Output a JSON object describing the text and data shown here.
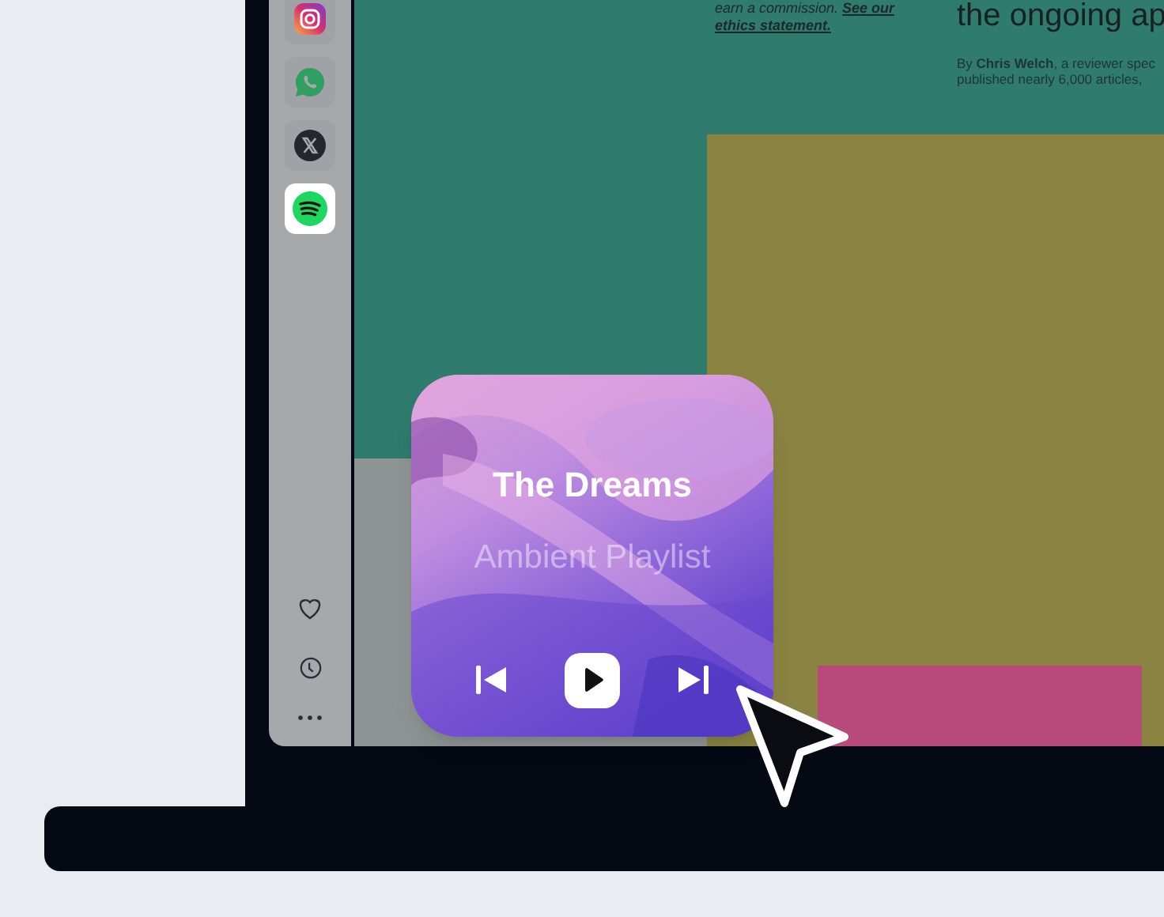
{
  "sidebar": {
    "apps": [
      {
        "kind": "instagram",
        "selected": false
      },
      {
        "kind": "whatsapp",
        "selected": false
      },
      {
        "kind": "x",
        "selected": false
      },
      {
        "kind": "spotify",
        "selected": true
      }
    ]
  },
  "article": {
    "note": "earn a commission.",
    "note_link": [
      "See our",
      "ethics statement."
    ],
    "headline": "the ongoing ap",
    "byline": [
      "By **Chris Welch**, a reviewer spec",
      "published nearly 6,000 articles,"
    ]
  },
  "player": {
    "title": "The Dreams",
    "subtitle": "Ambient Playlist",
    "controls": [
      {
        "kind": "previous"
      },
      {
        "kind": "play"
      },
      {
        "kind": "next"
      }
    ]
  }
}
